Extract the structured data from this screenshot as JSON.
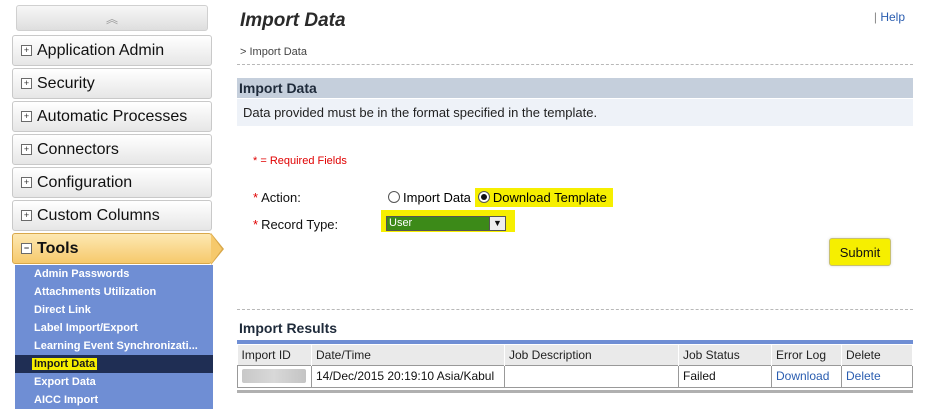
{
  "sidebar": {
    "collapse_glyph": "︽",
    "items": [
      {
        "label": "Application Admin",
        "glyph": "+"
      },
      {
        "label": "Security",
        "glyph": "+"
      },
      {
        "label": "Automatic Processes",
        "glyph": "+"
      },
      {
        "label": "Connectors",
        "glyph": "+"
      },
      {
        "label": "Configuration",
        "glyph": "+"
      },
      {
        "label": "Custom Columns",
        "glyph": "+"
      },
      {
        "label": "Tools",
        "glyph": "−"
      }
    ],
    "submenu": [
      "Admin Passwords",
      "Attachments Utilization",
      "Direct Link",
      "Label Import/Export",
      "Learning Event Synchronizati...",
      "Import Data",
      "Export Data",
      "AICC Import"
    ],
    "selected_submenu": "Import Data"
  },
  "main": {
    "title": "Import Data",
    "help_separator": "|",
    "help_label": "Help",
    "breadcrumb": "> Import Data",
    "section_title": "Import Data",
    "section_description": "Data provided must be in the format specified in the template.",
    "required_note": "* = Required Fields",
    "action": {
      "star": "*",
      "label": "Action:",
      "options": [
        "Import Data",
        "Download Template"
      ],
      "selected": "Download Template"
    },
    "record_type": {
      "star": "*",
      "label": "Record Type:",
      "value": "User"
    },
    "submit_label": "Submit",
    "results": {
      "title": "Import Results",
      "columns": [
        "Import ID",
        "Date/Time",
        "Job Description",
        "Job Status",
        "Error Log",
        "Delete"
      ],
      "rows": [
        {
          "import_id": "",
          "datetime": "14/Dec/2015 20:19:10 Asia/Kabul",
          "job_description": "",
          "job_status": "Failed",
          "error_log": "Download",
          "delete": "Delete"
        }
      ]
    }
  },
  "colors": {
    "highlight": "#f6ef00",
    "submenu_bg": "#6f8ed4",
    "active_tab": "#f6c96c",
    "section_header": "#c5cfdc",
    "link": "#2a5db0",
    "required": "#e00000"
  }
}
